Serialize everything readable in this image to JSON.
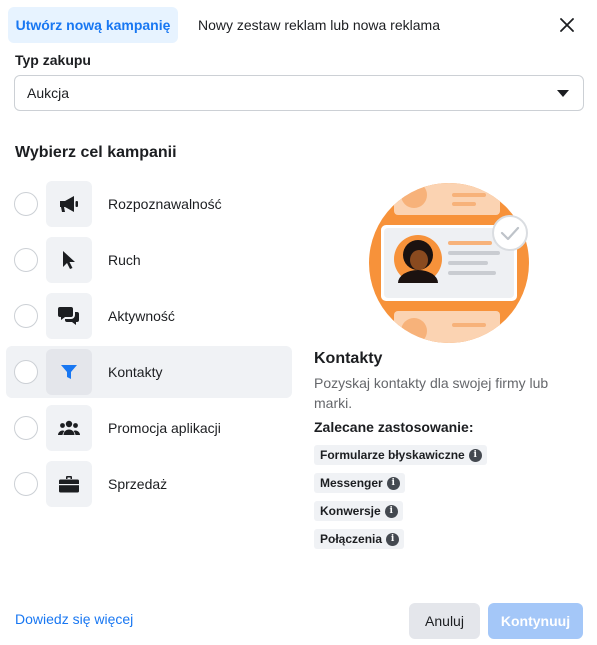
{
  "tabs": {
    "active": "Utwórz nową kampanię",
    "inactive": "Nowy zestaw reklam lub nowa reklama"
  },
  "purchase_type": {
    "label": "Typ zakupu",
    "value": "Aukcja"
  },
  "objective_section": {
    "title": "Wybierz cel kampanii",
    "items": [
      {
        "label": "Rozpoznawalność",
        "icon": "megaphone-icon",
        "selected": false
      },
      {
        "label": "Ruch",
        "icon": "cursor-icon",
        "selected": false
      },
      {
        "label": "Aktywność",
        "icon": "chat-bubbles-icon",
        "selected": false
      },
      {
        "label": "Kontakty",
        "icon": "funnel-icon",
        "selected": true
      },
      {
        "label": "Promocja aplikacji",
        "icon": "people-icon",
        "selected": false
      },
      {
        "label": "Sprzedaż",
        "icon": "briefcase-icon",
        "selected": false
      }
    ]
  },
  "detail": {
    "title": "Kontakty",
    "description": "Pozyskaj kontakty dla swojej firmy lub marki.",
    "usage_title": "Zalecane zastosowanie:",
    "chips": [
      "Formularze błyskawiczne",
      "Messenger",
      "Konwersje",
      "Połączenia"
    ],
    "info_glyph": "i"
  },
  "footer": {
    "learn_more": "Dowiedz się więcej",
    "cancel": "Anuluj",
    "continue": "Kontynuuj"
  },
  "colors": {
    "accent": "#1877f2",
    "accent_light": "#e7f3ff",
    "disabled_primary": "#a4c7f8",
    "illustration_orange": "#f7923a"
  }
}
